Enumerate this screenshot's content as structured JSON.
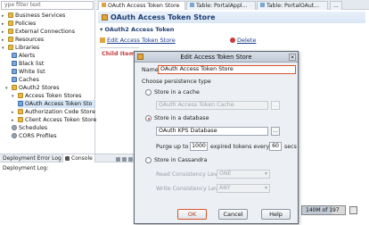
{
  "tree": {
    "filter_placeholder": "ype filter text",
    "items": [
      {
        "label": "Business Services"
      },
      {
        "label": "Policies"
      },
      {
        "label": "External Connections"
      },
      {
        "label": "Resources"
      },
      {
        "label": "Libraries"
      },
      {
        "label": "Alerts"
      },
      {
        "label": "Black list"
      },
      {
        "label": "White list"
      },
      {
        "label": "Caches"
      },
      {
        "label": "OAuth2 Stores"
      },
      {
        "label": "Access Token Stores"
      },
      {
        "label": "OAuth Access Token Sto"
      },
      {
        "label": "Authorization Code Store"
      },
      {
        "label": "Client Access Token Store"
      },
      {
        "label": "Schedules"
      },
      {
        "label": "CORS Profiles"
      }
    ]
  },
  "bottom": {
    "tabs": [
      "Deployment Error Log",
      "Console"
    ],
    "console_text": "Deployment Log:",
    "memory": "140M of 197",
    "memory_fraction": 0.71
  },
  "editor": {
    "tabs": [
      "OAuth Access Token Store",
      "Table: PortalAppl...",
      "Table: PortalOAut...",
      "..."
    ],
    "title": "OAuth Access Token Store",
    "section": "OAuth2 Access Token",
    "edit_link": "Edit Access Token Store",
    "delete_link": "Delete",
    "child_items": "Child Items"
  },
  "dialog": {
    "title": "Edit Access Token Store",
    "name_label": "Name",
    "name_value": "OAuth Access Token Store",
    "persistence_label": "Choose persistence type",
    "cache_option": "Store in a cache",
    "cache_value": "OAuth Access Token Cache",
    "db_option": "Store in a database",
    "db_value": "OAuth KPS Database",
    "purge_prefix": "Purge up to",
    "purge_count": "1000",
    "purge_middle": "expired tokens every",
    "purge_interval": "60",
    "purge_unit": "secs",
    "cassandra_option": "Store in Cassandra",
    "read_label": "Read Consistency Level",
    "read_value": "ONE",
    "write_label": "Write Consistency Level",
    "write_value": "ANY",
    "browse": "...",
    "ok": "OK",
    "cancel": "Cancel",
    "help": "Help",
    "selected_option": "database"
  },
  "colors": {
    "accent": "#d9542b",
    "selection": "#d7e6f7",
    "link": "#1a3a8a"
  }
}
